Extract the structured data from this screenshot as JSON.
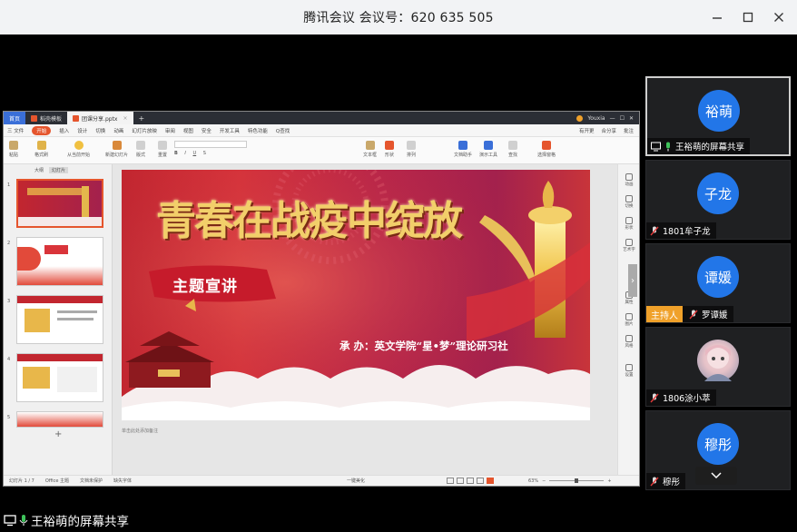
{
  "window": {
    "title": "腾讯会议 会议号：620 635 505",
    "controls": {
      "minimize": "—",
      "maximize": "☐",
      "close": "✕"
    }
  },
  "wps": {
    "tabs": [
      {
        "label": "首页"
      },
      {
        "label": "稻壳模板"
      },
      {
        "label": "团课分享.pptx"
      }
    ],
    "plus": "+",
    "user": "Youxia",
    "menubar": {
      "file": "三 文件",
      "items": [
        "开始",
        "插入",
        "设计",
        "切换",
        "动画",
        "幻灯片放映",
        "审阅",
        "视图",
        "安全",
        "开发工具",
        "特色功能"
      ],
      "search": "Q查找",
      "right": [
        "有开更",
        "合分享",
        "批注"
      ]
    },
    "ribbon": {
      "labels": [
        "粘贴",
        "格式刷",
        "从当前开始",
        "新建幻灯片",
        "版式",
        "重置",
        "节",
        "文本框",
        "形状",
        "排列",
        "文档助手",
        "演示工具",
        "查找",
        "替换",
        "选择窗格"
      ]
    },
    "thumbs": {
      "header": [
        "大纲",
        "幻灯片"
      ],
      "numbers": [
        "1",
        "2",
        "3",
        "4",
        "5"
      ],
      "add": "+"
    },
    "slide": {
      "title": "青春在战疫中绽放",
      "subtitle": "主题宣讲",
      "organizer": "承 办：英文学院“星•梦”理论研习社"
    },
    "notes_placeholder": "单击此处添加备注",
    "side_tools": [
      "动画",
      "切换",
      "形状",
      "艺术字",
      "属性",
      "图片",
      "风格",
      "设置"
    ],
    "status": {
      "slide": "幻灯片 1 / 7",
      "theme": "Office 主题",
      "protect": "文档未保护",
      "font": "缺失字体",
      "beautify": "一键美化",
      "zoom": "63%"
    }
  },
  "share_label": "王裕萌的屏幕共享",
  "participants": [
    {
      "avatar": "裕萌",
      "name": "王裕萌的屏幕共享",
      "host": false,
      "photo": false
    },
    {
      "avatar": "子龙",
      "name": "1801牟子龙",
      "host": false,
      "photo": false
    },
    {
      "avatar": "谭媛",
      "name": "罗谭媛",
      "host": true,
      "host_label": "主持人",
      "photo": false
    },
    {
      "avatar": "",
      "name": "1806涂小萃",
      "host": false,
      "photo": true
    },
    {
      "avatar": "穆彤",
      "name": "穆彤",
      "host": false,
      "photo": false
    }
  ],
  "scroll_down": "⌄",
  "colors": {
    "meeting_blue": "#2276e8",
    "host_orange": "#f0a12a",
    "wps_accent": "#e5552d"
  }
}
